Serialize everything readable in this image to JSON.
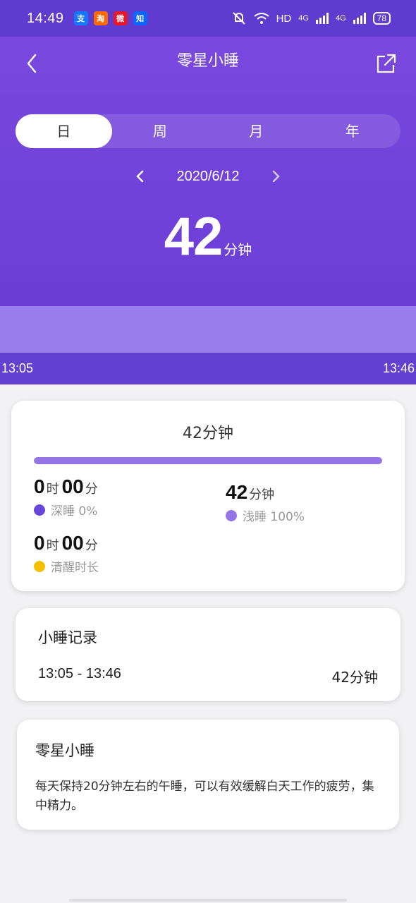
{
  "status_bar": {
    "time": "14:49",
    "apps": [
      {
        "name": "alipay-icon",
        "glyph": "支",
        "color": "#1677ff"
      },
      {
        "name": "taobao-icon",
        "glyph": "淘",
        "color": "#ff6a00"
      },
      {
        "name": "weibo-icon",
        "glyph": "微",
        "color": "#e6162d"
      },
      {
        "name": "zhihu-icon",
        "glyph": "知",
        "color": "#0a66ff"
      }
    ],
    "network": "HD",
    "signal1": "4G",
    "signal2": "4G",
    "battery": "78"
  },
  "header": {
    "title": "零星小睡",
    "tabs": [
      "日",
      "周",
      "月",
      "年"
    ],
    "active_tab": 0,
    "date": "2020/6/12",
    "total_value": "42",
    "total_unit": "分钟",
    "timeline_start": "13:05",
    "timeline_end": "13:46"
  },
  "summary": {
    "title": "42分钟",
    "progress_light_fraction": 1.0,
    "deep": {
      "h": "0",
      "h_unit": "时",
      "m": "00",
      "m_unit": "分",
      "label": "深睡 0%",
      "color": "#6a47d8"
    },
    "light": {
      "m": "42",
      "m_unit": "分钟",
      "label": "浅睡 100%",
      "color": "#9575e6"
    },
    "awake": {
      "h": "0",
      "h_unit": "时",
      "m": "00",
      "m_unit": "分",
      "label": "清醒时长",
      "color": "#f5c000"
    }
  },
  "records": {
    "title": "小睡记录",
    "items": [
      {
        "range": "13:05 - 13:46",
        "duration": "42分钟"
      }
    ]
  },
  "tip": {
    "title": "零星小睡",
    "text": "每天保持20分钟左右的午睡，可以有效缓解白天工作的疲劳，集中精力。"
  }
}
